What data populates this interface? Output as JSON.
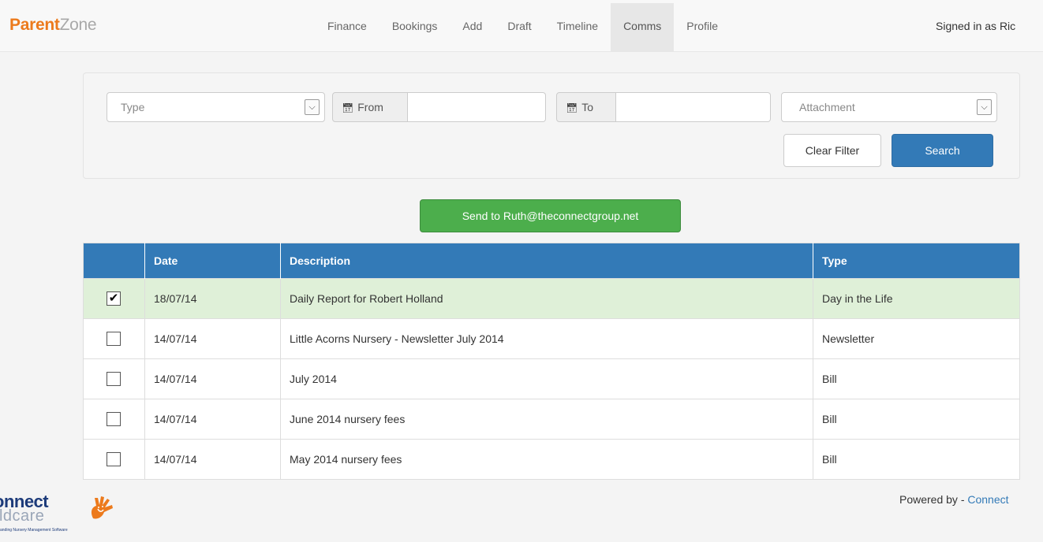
{
  "brand": {
    "part1": "Parent",
    "part2": "Zone"
  },
  "nav": {
    "items": [
      {
        "label": "Finance"
      },
      {
        "label": "Bookings"
      },
      {
        "label": "Add"
      },
      {
        "label": "Draft"
      },
      {
        "label": "Timeline"
      },
      {
        "label": "Comms",
        "active": true
      },
      {
        "label": "Profile"
      }
    ],
    "signed_in": "Signed in as Ric"
  },
  "filters": {
    "type_placeholder": "Type",
    "from_label": "From",
    "to_label": "To",
    "attachment_placeholder": "Attachment",
    "clear_label": "Clear Filter",
    "search_label": "Search"
  },
  "send_button": "Send to Ruth@theconnectgroup.net",
  "table": {
    "headers": [
      "",
      "Date",
      "Description",
      "Type"
    ],
    "rows": [
      {
        "checked": true,
        "date": "18/07/14",
        "description": "Daily Report for Robert Holland",
        "type": "Day in the Life"
      },
      {
        "checked": false,
        "date": "14/07/14",
        "description": "Little Acorns Nursery - Newsletter July 2014",
        "type": "Newsletter"
      },
      {
        "checked": false,
        "date": "14/07/14",
        "description": "July 2014",
        "type": "Bill"
      },
      {
        "checked": false,
        "date": "14/07/14",
        "description": "June 2014 nursery fees",
        "type": "Bill"
      },
      {
        "checked": false,
        "date": "14/07/14",
        "description": "May 2014 nursery fees",
        "type": "Bill"
      }
    ]
  },
  "footer": {
    "logo_connect": "onnect",
    "logo_childcare": "ildcare",
    "logo_tag": "anding Nursery Management Software",
    "powered_prefix": "Powered by - ",
    "powered_link": "Connect"
  },
  "colors": {
    "brand_orange": "#ec7a1c",
    "primary": "#337ab7",
    "success": "#4cae4c",
    "selected_row": "#dff0d8"
  },
  "icons": {
    "calendar": "calendar-icon",
    "chevron": "chevron-down-icon",
    "check": "check-icon"
  }
}
